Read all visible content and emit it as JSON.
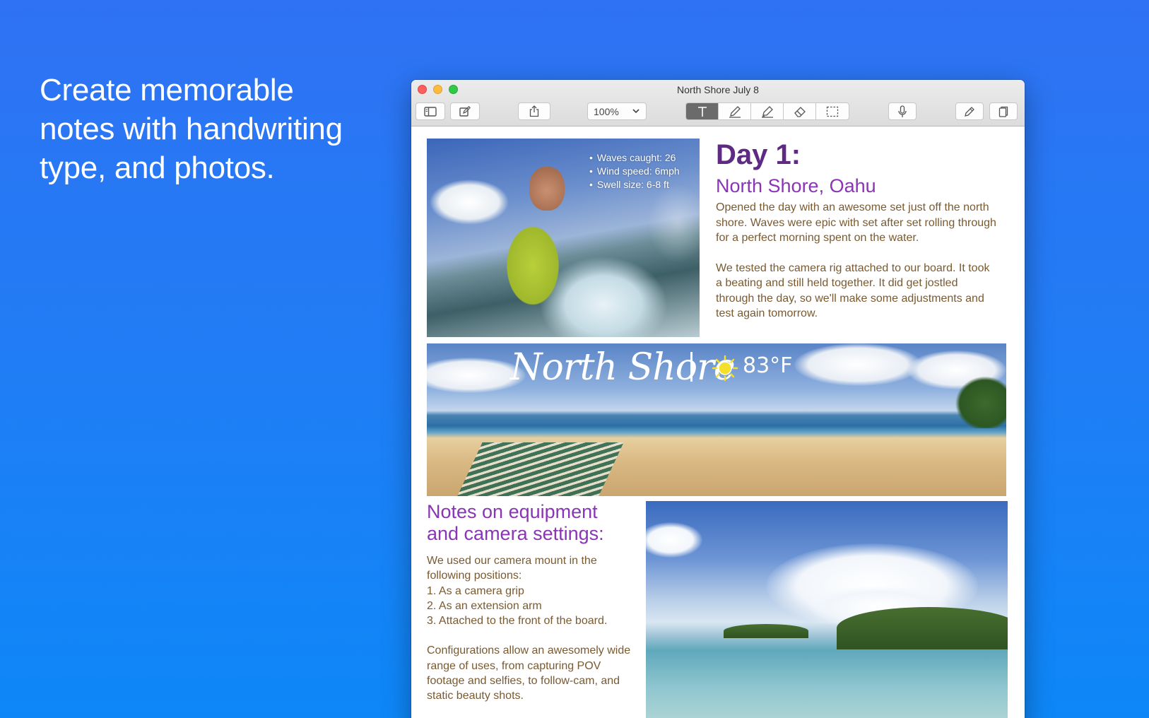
{
  "tagline": [
    "Create memorable",
    "notes with handwriting",
    "type, and photos."
  ],
  "window": {
    "title": "North Shore July 8",
    "zoom": "100%",
    "toolbar_icons": [
      "sidebar-icon",
      "compose-icon",
      "share-icon",
      "text-tool-icon",
      "pen-icon",
      "highlighter-icon",
      "eraser-icon",
      "selection-icon",
      "microphone-icon",
      "pen-settings-icon",
      "pages-icon"
    ],
    "active_tool": "text-tool",
    "accent_color": "#6b6b6b"
  },
  "note": {
    "photo_stats": [
      "Waves caught: 26",
      "Wind speed: 6mph",
      "Swell size: 6-8 ft"
    ],
    "heading": "Day 1:",
    "subheading": "North Shore, Oahu",
    "paragraph1": "Opened the day with an awesome set just off the north shore. Waves were epic with set after set rolling through for a perfect morning spent on the water.",
    "paragraph2": "We tested the camera rig attached to our board. It took a beating and still held together. It did get jostled through the day, so we'll make some adjustments and test again tomorrow.",
    "handwriting": "North Shore",
    "temperature": "83°F",
    "notes_title": "Notes on equipment and camera settings:",
    "notes_intro": "We used our camera mount in the following positions:",
    "notes_list": [
      "1. As a camera grip",
      "2. As an extension arm",
      "3. Attached to the front of the board."
    ],
    "notes_outro": "Configurations allow an awesomely wide range of uses, from capturing POV footage and selfies, to follow-cam, and static beauty shots.",
    "colors": {
      "heading": "#5e2a84",
      "subheading": "#8a35b5",
      "body_text": "#7a5a30"
    }
  }
}
